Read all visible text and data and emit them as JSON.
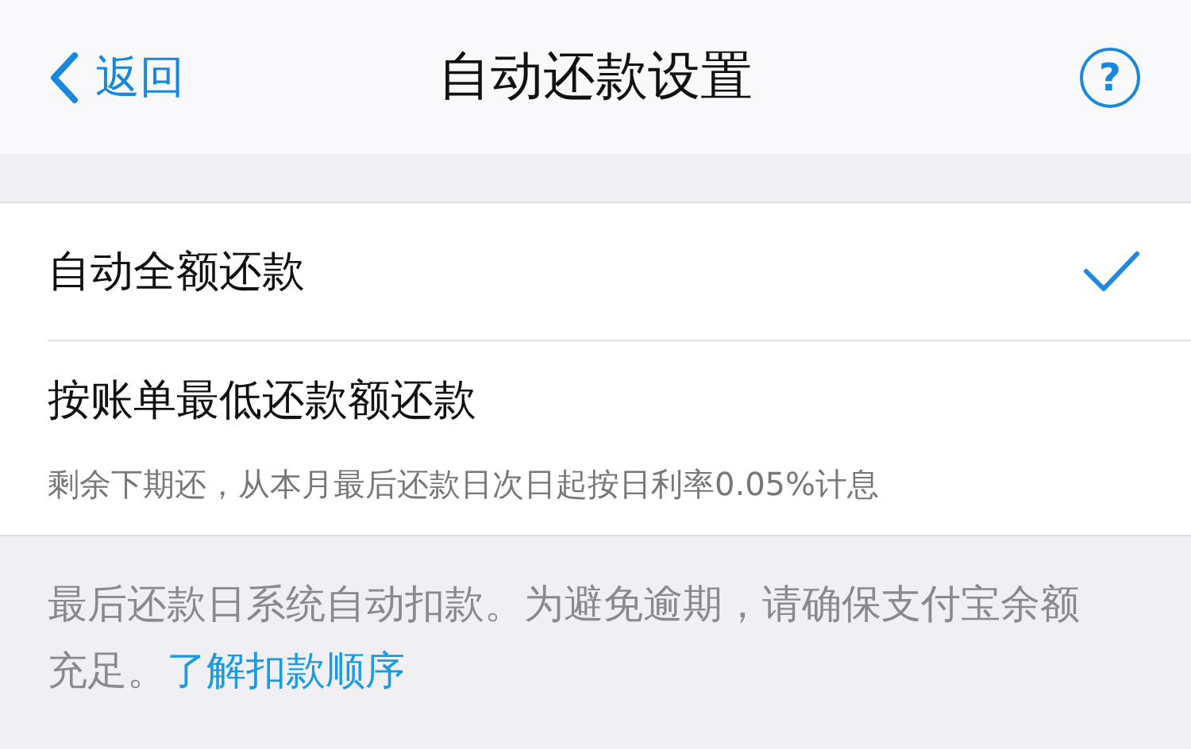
{
  "nav": {
    "back": "返回",
    "title": "自动还款设置",
    "help": "?"
  },
  "options": [
    {
      "label": "自动全额还款",
      "selected": true
    },
    {
      "label": "按账单最低还款额还款",
      "description": "剩余下期还，从本月最后还款日次日起按日利率0.05%计息",
      "selected": false
    }
  ],
  "footer": {
    "text": "最后还款日系统自动扣款。为避免逾期，请确保支付宝余额充足。",
    "link": "了解扣款顺序"
  }
}
